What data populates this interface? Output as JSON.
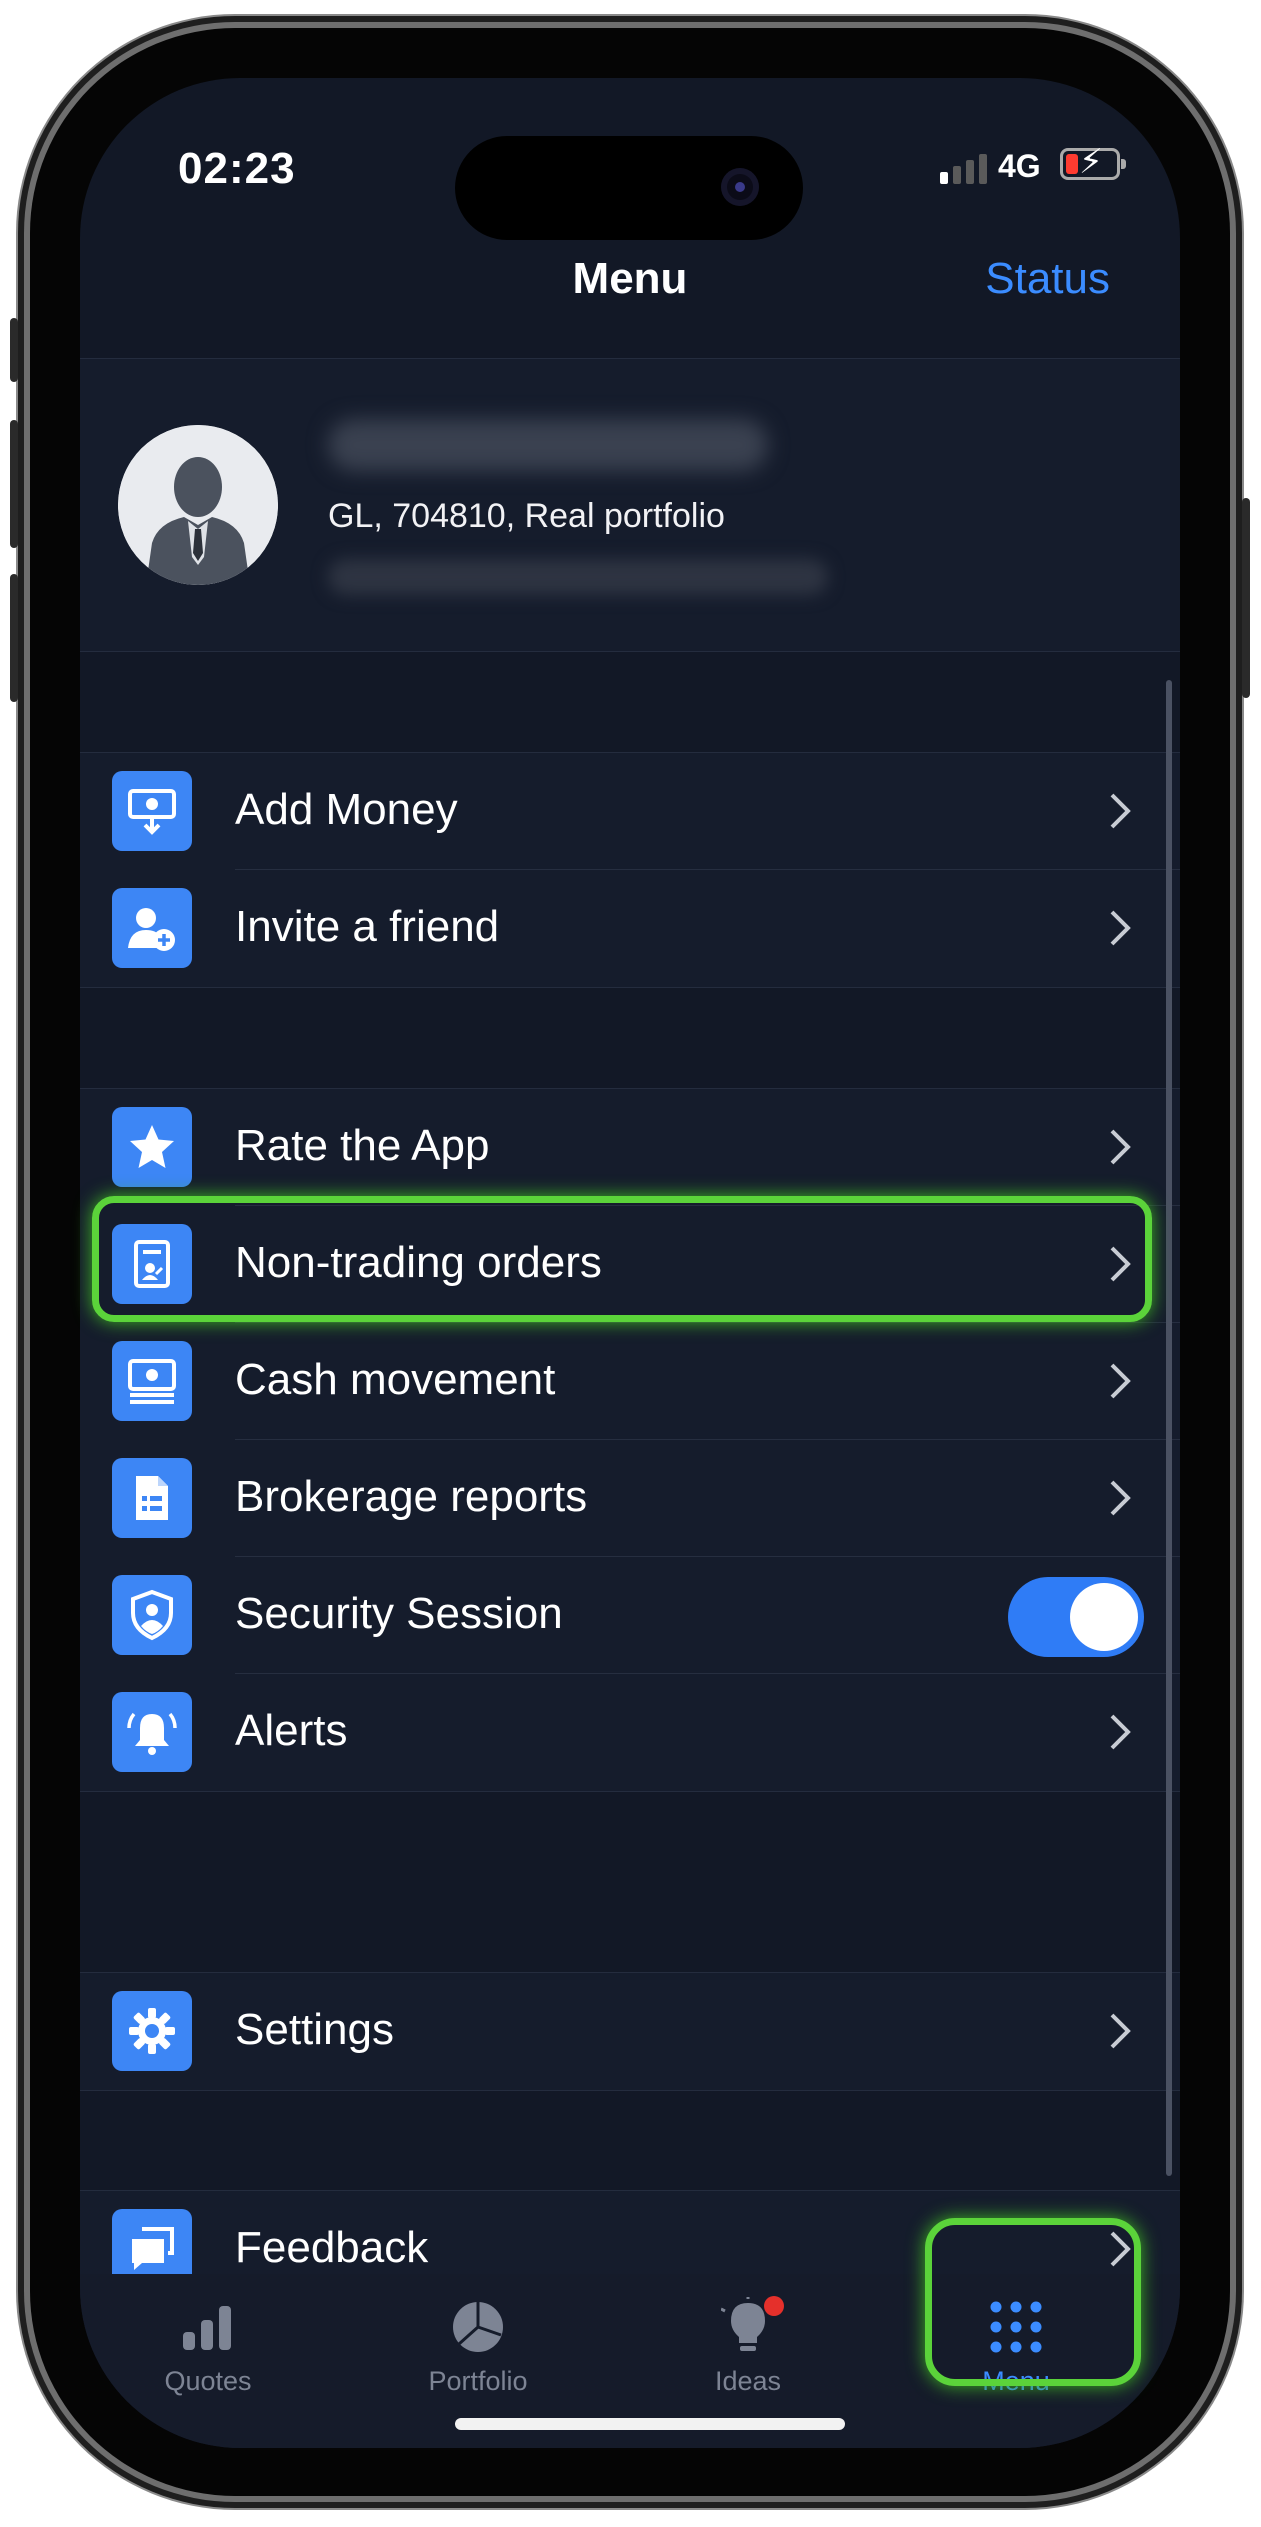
{
  "status_bar": {
    "time": "02:23",
    "network": "4G"
  },
  "nav": {
    "title": "Menu",
    "status_link": "Status"
  },
  "profile": {
    "account": "GL, 704810, Real portfolio"
  },
  "groups": [
    {
      "items": [
        {
          "label": "Add Money",
          "icon": "add-money-icon"
        },
        {
          "label": "Invite a friend",
          "icon": "invite-user-icon"
        }
      ]
    },
    {
      "items": [
        {
          "label": "Rate the App",
          "icon": "star-icon"
        },
        {
          "label": "Non-trading orders",
          "icon": "document-icon"
        },
        {
          "label": "Cash movement",
          "icon": "cash-icon"
        },
        {
          "label": "Brokerage reports",
          "icon": "report-icon"
        },
        {
          "label": "Security Session",
          "icon": "shield-icon",
          "toggle_on": true
        },
        {
          "label": "Alerts",
          "icon": "bell-icon"
        }
      ]
    },
    {
      "items": [
        {
          "label": "Settings",
          "icon": "gear-icon"
        }
      ]
    },
    {
      "items": [
        {
          "label": "Feedback",
          "icon": "chat-icon"
        }
      ]
    }
  ],
  "tabs": [
    {
      "label": "Quotes",
      "icon": "bar-chart-icon"
    },
    {
      "label": "Portfolio",
      "icon": "pie-chart-icon"
    },
    {
      "label": "Ideas",
      "icon": "lightbulb-icon",
      "badge": true
    },
    {
      "label": "Menu",
      "icon": "grid-dots-icon",
      "active": true
    }
  ],
  "colors": {
    "accent": "#3b8cff",
    "icon_bg": "#3d86f5",
    "highlight": "#5bd33a",
    "background": "#121826"
  }
}
